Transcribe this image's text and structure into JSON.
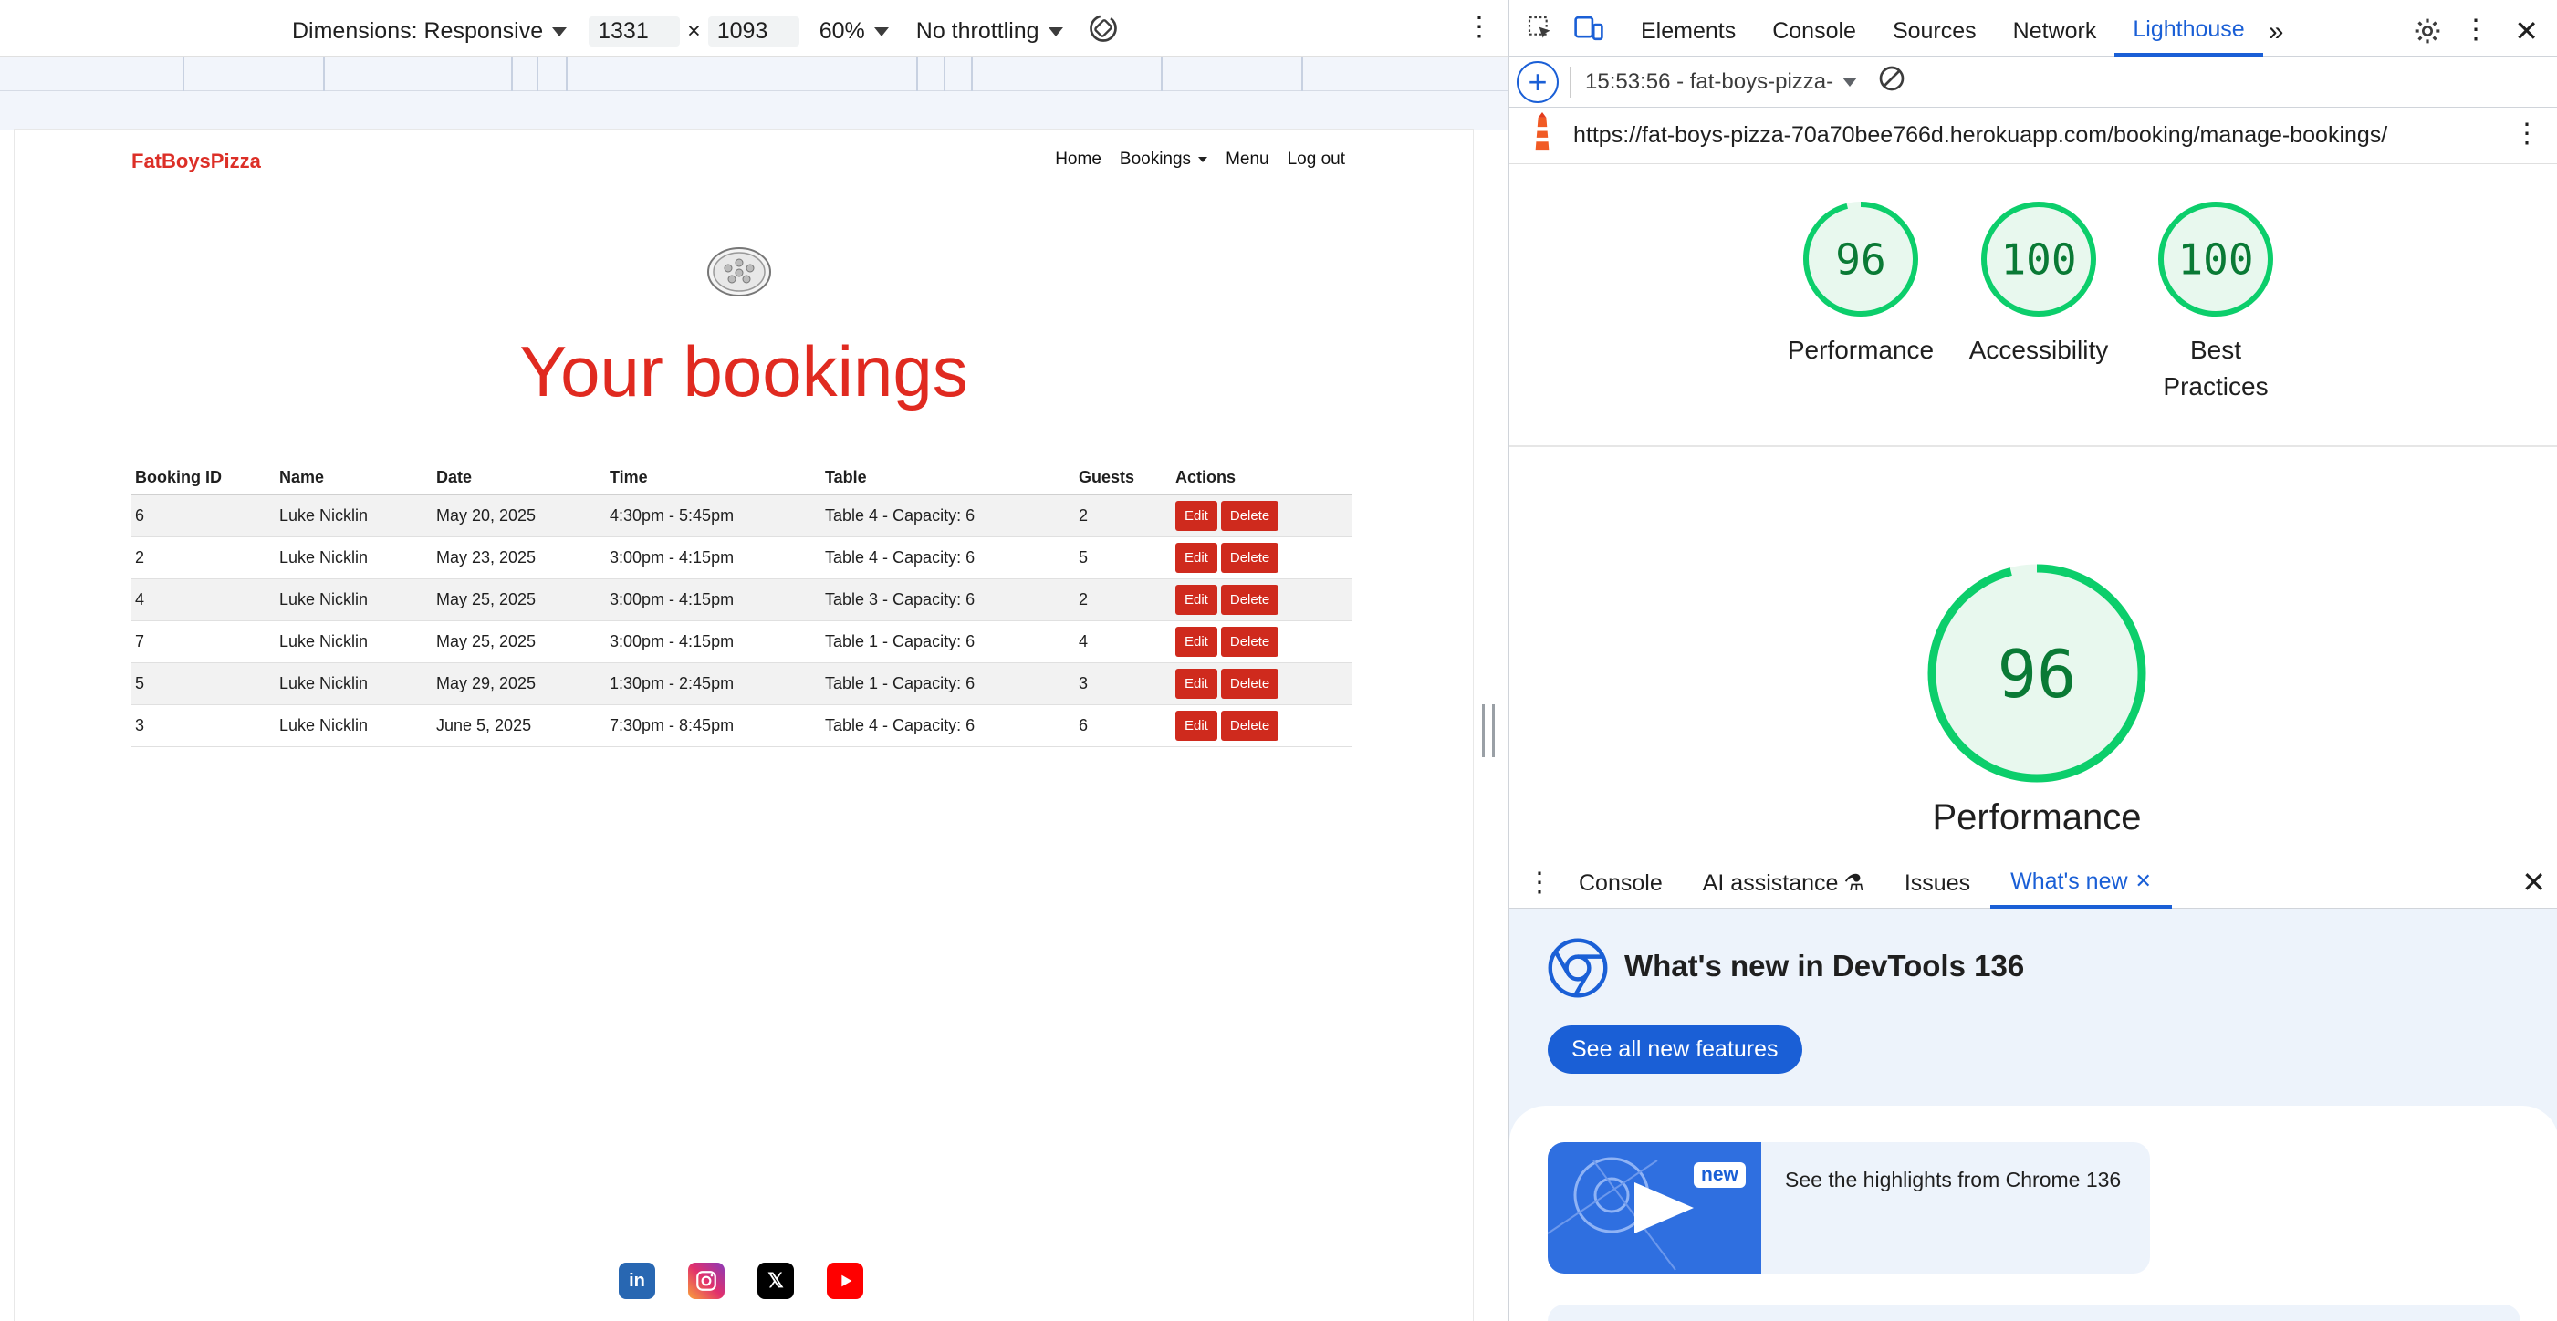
{
  "device_toolbar": {
    "dimensions_label": "Dimensions: Responsive",
    "width": "1331",
    "times": "×",
    "height": "1093",
    "zoom": "60%",
    "throttling": "No throttling"
  },
  "site": {
    "brand": "FatBoysPizza",
    "nav": {
      "home": "Home",
      "bookings": "Bookings",
      "menu": "Menu",
      "logout": "Log out"
    },
    "heading": "Your bookings",
    "table": {
      "headers": [
        "Booking ID",
        "Name",
        "Date",
        "Time",
        "Table",
        "Guests",
        "Actions"
      ],
      "rows": [
        {
          "id": "6",
          "name": "Luke Nicklin",
          "date": "May 20, 2025",
          "time": "4:30pm - 5:45pm",
          "table": "Table 4 - Capacity: 6",
          "guests": "2"
        },
        {
          "id": "2",
          "name": "Luke Nicklin",
          "date": "May 23, 2025",
          "time": "3:00pm - 4:15pm",
          "table": "Table 4 - Capacity: 6",
          "guests": "5"
        },
        {
          "id": "4",
          "name": "Luke Nicklin",
          "date": "May 25, 2025",
          "time": "3:00pm - 4:15pm",
          "table": "Table 3 - Capacity: 6",
          "guests": "2"
        },
        {
          "id": "7",
          "name": "Luke Nicklin",
          "date": "May 25, 2025",
          "time": "3:00pm - 4:15pm",
          "table": "Table 1 - Capacity: 6",
          "guests": "4"
        },
        {
          "id": "5",
          "name": "Luke Nicklin",
          "date": "May 29, 2025",
          "time": "1:30pm - 2:45pm",
          "table": "Table 1 - Capacity: 6",
          "guests": "3"
        },
        {
          "id": "3",
          "name": "Luke Nicklin",
          "date": "June 5, 2025",
          "time": "7:30pm - 8:45pm",
          "table": "Table 4 - Capacity: 6",
          "guests": "6"
        }
      ],
      "edit_label": "Edit",
      "delete_label": "Delete"
    },
    "social": [
      "linkedin-icon",
      "instagram-icon",
      "x-icon",
      "youtube-icon"
    ]
  },
  "devtools": {
    "tabs": [
      "Elements",
      "Console",
      "Sources",
      "Network",
      "Lighthouse"
    ],
    "active_tab": "Lighthouse",
    "report_label": "15:53:56 - fat-boys-pizza-",
    "url": "https://fat-boys-pizza-70a70bee766d.herokuapp.com/booking/manage-bookings/",
    "scores": [
      {
        "score": "96",
        "label": "Performance",
        "value": 0.96
      },
      {
        "score": "100",
        "label": "Accessibility",
        "value": 1.0
      },
      {
        "score": "100",
        "label": "Best Practices",
        "value": 1.0
      }
    ],
    "big_score": {
      "score": "96",
      "label": "Performance",
      "value": 0.96
    },
    "score_color": "#0cce6b",
    "drawer": {
      "tabs": [
        "Console",
        "AI assistance",
        "Issues",
        "What's new"
      ],
      "active_tab": "What's new",
      "title": "What's new in DevTools 136",
      "button": "See all new features",
      "highlight_badge": "new",
      "highlight_text": "See the highlights from Chrome 136"
    }
  }
}
